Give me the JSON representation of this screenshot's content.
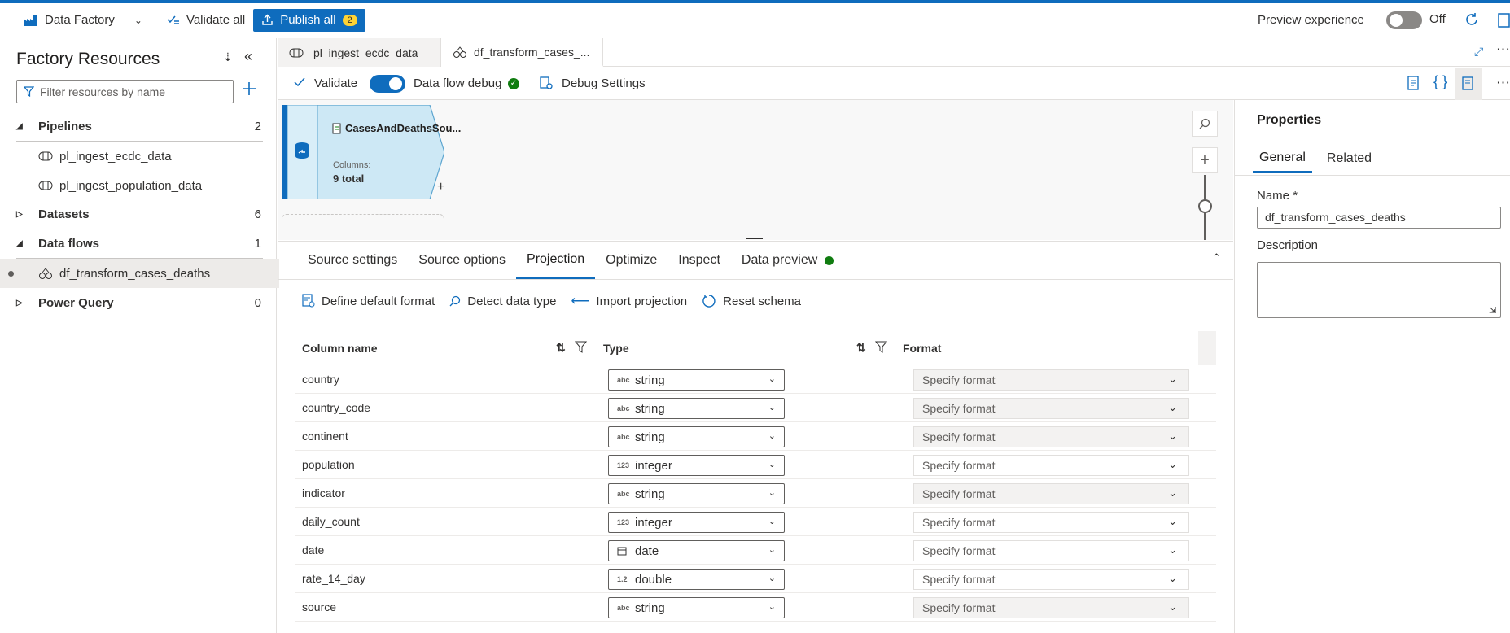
{
  "toolbar": {
    "app_name": "Data Factory",
    "validate_all": "Validate all",
    "publish_all": "Publish all",
    "publish_count": "2",
    "preview_experience": "Preview experience",
    "toggle_state": "Off"
  },
  "resources": {
    "title": "Factory Resources",
    "filter_placeholder": "Filter resources by name",
    "groups": [
      {
        "label": "Pipelines",
        "count": "2"
      },
      {
        "label": "Datasets",
        "count": "6"
      },
      {
        "label": "Data flows",
        "count": "1"
      },
      {
        "label": "Power Query",
        "count": "0"
      }
    ],
    "pipelines": [
      "pl_ingest_ecdc_data",
      "pl_ingest_population_data"
    ],
    "dataflows": [
      "df_transform_cases_deaths"
    ]
  },
  "tabs": [
    {
      "label": "pl_ingest_ecdc_data"
    },
    {
      "label": "df_transform_cases_..."
    }
  ],
  "subbar": {
    "validate": "Validate",
    "data_flow_debug": "Data flow debug",
    "debug_settings": "Debug Settings"
  },
  "node": {
    "name": "CasesAndDeathsSou...",
    "columns_label": "Columns:",
    "columns_value": "9 total"
  },
  "bottom_tabs": [
    "Source settings",
    "Source options",
    "Projection",
    "Optimize",
    "Inspect",
    "Data preview"
  ],
  "actions": [
    "Define default format",
    "Detect data type",
    "Import projection",
    "Reset schema"
  ],
  "grid": {
    "headers": {
      "name": "Column name",
      "type": "Type",
      "format": "Format"
    },
    "format_placeholder": "Specify format",
    "rows": [
      {
        "name": "country",
        "icon": "abc",
        "type": "string",
        "format_disabled": true
      },
      {
        "name": "country_code",
        "icon": "abc",
        "type": "string",
        "format_disabled": true
      },
      {
        "name": "continent",
        "icon": "abc",
        "type": "string",
        "format_disabled": true
      },
      {
        "name": "population",
        "icon": "123",
        "type": "integer",
        "format_disabled": false
      },
      {
        "name": "indicator",
        "icon": "abc",
        "type": "string",
        "format_disabled": true
      },
      {
        "name": "daily_count",
        "icon": "123",
        "type": "integer",
        "format_disabled": false
      },
      {
        "name": "date",
        "icon": "calendar-icon",
        "type": "date",
        "format_disabled": false
      },
      {
        "name": "rate_14_day",
        "icon": "1.2",
        "type": "double",
        "format_disabled": false
      },
      {
        "name": "source",
        "icon": "abc",
        "type": "string",
        "format_disabled": true
      }
    ]
  },
  "properties": {
    "title": "Properties",
    "tabs": [
      "General",
      "Related"
    ],
    "name_label": "Name",
    "name_required": "*",
    "name_value": "df_transform_cases_deaths",
    "description_label": "Description",
    "description_value": ""
  },
  "colors": {
    "accent": "#0f6cbd",
    "success": "#107c10",
    "badge": "#ffd335",
    "node_fill": "#cde8f5"
  }
}
